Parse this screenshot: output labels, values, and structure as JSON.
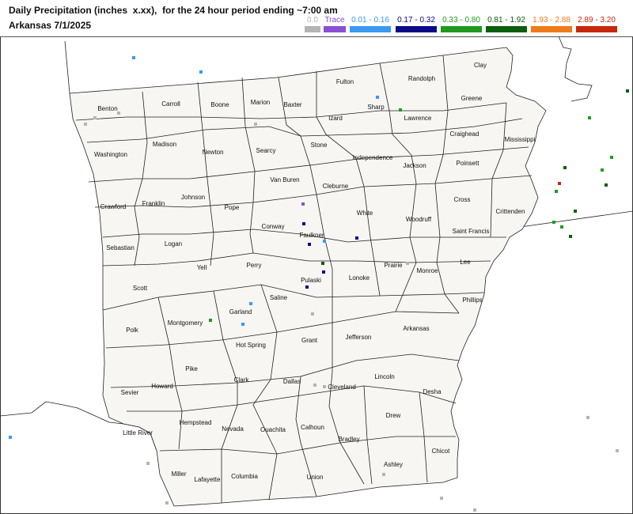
{
  "title": {
    "line1": "Daily Precipitation (inches  x.xx),  for the 24 hour period ending ~7:00 am",
    "line2": "Arkansas 7/1/2025"
  },
  "legend": [
    {
      "label": "0.0",
      "color": "#b4b4b4"
    },
    {
      "label": "Trace",
      "color": "#8a4fd6"
    },
    {
      "label": "0.01 - 0.16",
      "color": "#3a9af2"
    },
    {
      "label": "0.17 - 0.32",
      "color": "#0a0a8a"
    },
    {
      "label": "0.33 - 0.80",
      "color": "#1f9a1f"
    },
    {
      "label": "0.81 - 1.92",
      "color": "#0b5e0b"
    },
    {
      "label": "1.93 - 2.88",
      "color": "#f07a1a"
    },
    {
      "label": "2.89 - 3.20",
      "color": "#c8280a"
    }
  ],
  "counties": {
    "benton": "Benton",
    "carroll": "Carroll",
    "boone": "Boone",
    "marion": "Marion",
    "baxter": "Baxter",
    "fulton": "Fulton",
    "randolph": "Randolph",
    "clay": "Clay",
    "sharp": "Sharp",
    "izard": "Izard",
    "lawrence": "Lawrence",
    "greene": "Greene",
    "washington": "Washington",
    "madison": "Madison",
    "newton": "Newton",
    "searcy": "Searcy",
    "stone": "Stone",
    "independence": "Independence",
    "craighead": "Craighead",
    "mississippi": "Mississippi",
    "jackson": "Jackson",
    "poinsett": "Poinsett",
    "crawford": "Crawford",
    "franklin": "Franklin",
    "johnson": "Johnson",
    "pope": "Pope",
    "van_buren": "Van Buren",
    "cleburne": "Cleburne",
    "white": "White",
    "cross": "Cross",
    "crittenden": "Crittenden",
    "woodruff": "Woodruff",
    "conway": "Conway",
    "faulkner": "Faulkner",
    "saint_francis": "Saint Francis",
    "sebastian": "Sebastian",
    "logan": "Logan",
    "yell": "Yell",
    "perry": "Perry",
    "lonoke": "Lonoke",
    "prairie": "Prairie",
    "lee": "Lee",
    "monroe": "Monroe",
    "pulaski": "Pulaski",
    "scott": "Scott",
    "saline": "Saline",
    "phillips": "Phillips",
    "garland": "Garland",
    "polk": "Polk",
    "montgomery": "Montgomery",
    "arkansas": "Arkansas",
    "grant": "Grant",
    "jefferson": "Jefferson",
    "hot_spring": "Hot Spring",
    "pike": "Pike",
    "lincoln": "Lincoln",
    "howard": "Howard",
    "clark": "Clark",
    "dallas": "Dallas",
    "cleveland": "Cleveland",
    "sevier": "Sevier",
    "desha": "Desha",
    "hempstead": "Hempstead",
    "little_river": "Little River",
    "nevada": "Nevada",
    "ouachita": "Ouachita",
    "calhoun": "Calhoun",
    "drew": "Drew",
    "bradley": "Bradley",
    "chicot": "Chicot",
    "miller": "Miller",
    "lafayette": "Lafayette",
    "columbia": "Columbia",
    "union": "Union",
    "ashley": "Ashley"
  }
}
